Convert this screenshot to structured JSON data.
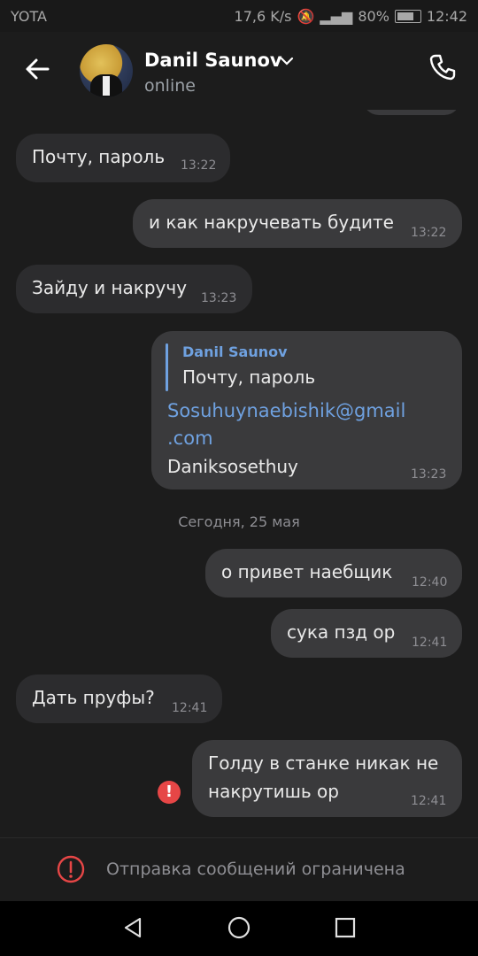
{
  "statusbar": {
    "carrier": "YOTA",
    "speed": "17,6 K/s",
    "battery": "80%",
    "time": "12:42"
  },
  "header": {
    "name": "Danil Saunov",
    "status": "online",
    "icons": [
      "back-arrow-icon",
      "chevron-down-icon",
      "phone-icon"
    ]
  },
  "messages": [
    {
      "direction": "in",
      "text": "Почту, пароль",
      "time": "13:22"
    },
    {
      "direction": "out",
      "text": "и как накручевать будите",
      "time": "13:22"
    },
    {
      "direction": "in",
      "text": "Зайду и накручу",
      "time": "13:23"
    },
    {
      "direction": "out",
      "reply_to": {
        "name": "Danil Saunov",
        "text": "Почту, пароль"
      },
      "link_line1": "Sosuhuynaebishik@gmail",
      "link_line2": ".com",
      "text": "Daniksosethuy",
      "time": "13:23"
    },
    {
      "direction": "out",
      "text": "о привет наебщик",
      "time": "12:40"
    },
    {
      "direction": "out",
      "text": "сука пзд ор",
      "time": "12:41"
    },
    {
      "direction": "in",
      "text": "Дать пруфы?",
      "time": "12:41"
    },
    {
      "direction": "out",
      "line1": "Голду в станке никак не",
      "line2": "накрутишь ор",
      "time": "12:41",
      "failed": true
    }
  ],
  "date_separator": "Сегодня, 25 мая",
  "footer": {
    "notice": "Отправка сообщений ограничена",
    "icon": "warning-icon"
  },
  "colors": {
    "background": "#1c1c1c",
    "incoming": "#2c2c2e",
    "outgoing": "#3a3a3c",
    "accent": "#6fa1e0",
    "error": "#e64646"
  }
}
